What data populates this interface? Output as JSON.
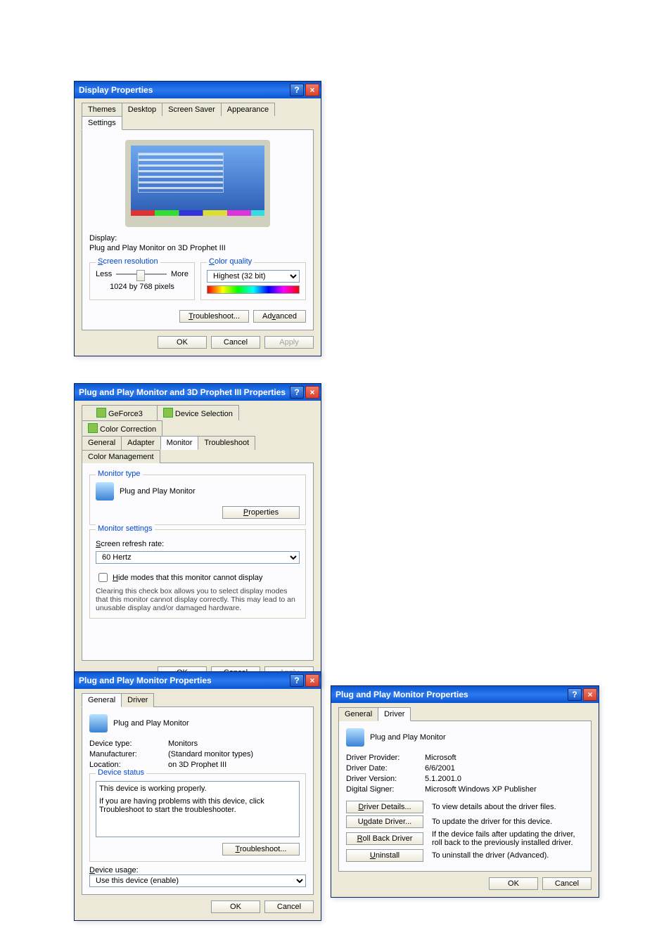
{
  "dlg1": {
    "title": "Display Properties",
    "tabs": [
      "Themes",
      "Desktop",
      "Screen Saver",
      "Appearance",
      "Settings"
    ],
    "selected_tab": "Settings",
    "display_label": "Display:",
    "display_value": "Plug and Play Monitor on 3D Prophet III",
    "res_legend": "Screen resolution",
    "res_less": "Less",
    "res_more": "More",
    "res_value": "1024 by 768 pixels",
    "cq_legend": "Color quality",
    "cq_value": "Highest (32 bit)",
    "troubleshoot_btn": "Troubleshoot...",
    "advanced_btn": "Advanced",
    "ok": "OK",
    "cancel": "Cancel",
    "apply": "Apply"
  },
  "dlg2": {
    "title": "Plug and Play Monitor and 3D Prophet III Properties",
    "tabs_row1": [
      "GeForce3",
      "Device Selection",
      "Color Correction"
    ],
    "tabs_row2": [
      "General",
      "Adapter",
      "Monitor",
      "Troubleshoot",
      "Color Management"
    ],
    "selected_tab": "Monitor",
    "mt_legend": "Monitor type",
    "mt_name": "Plug and Play Monitor",
    "properties_btn": "Properties",
    "ms_legend": "Monitor settings",
    "refresh_label": "Screen refresh rate:",
    "refresh_value": "60 Hertz",
    "hide_modes": "Hide modes that this monitor cannot display",
    "hide_help": "Clearing this check box allows you to select display modes that this monitor cannot display correctly. This may lead to an unusable display and/or damaged hardware.",
    "ok": "OK",
    "cancel": "Cancel",
    "apply": "Apply"
  },
  "dlg3": {
    "title": "Plug and Play Monitor Properties",
    "tabs": [
      "General",
      "Driver"
    ],
    "selected_tab": "General",
    "header": "Plug and Play Monitor",
    "devtype_l": "Device type:",
    "devtype_v": "Monitors",
    "mfr_l": "Manufacturer:",
    "mfr_v": "(Standard monitor types)",
    "loc_l": "Location:",
    "loc_v": "on 3D Prophet III",
    "status_legend": "Device status",
    "status_text": "This device is working properly.",
    "status_help": "If you are having problems with this device, click Troubleshoot to start the troubleshooter.",
    "troubleshoot_btn": "Troubleshoot...",
    "usage_label": "Device usage:",
    "usage_value": "Use this device (enable)",
    "ok": "OK",
    "cancel": "Cancel"
  },
  "dlg4": {
    "title": "Plug and Play Monitor Properties",
    "tabs": [
      "General",
      "Driver"
    ],
    "selected_tab": "Driver",
    "header": "Plug and Play Monitor",
    "provider_l": "Driver Provider:",
    "provider_v": "Microsoft",
    "date_l": "Driver Date:",
    "date_v": "6/6/2001",
    "version_l": "Driver Version:",
    "version_v": "5.1.2001.0",
    "signer_l": "Digital Signer:",
    "signer_v": "Microsoft Windows XP Publisher",
    "details_btn": "Driver Details...",
    "details_txt": "To view details about the driver files.",
    "update_btn": "Update Driver...",
    "update_txt": "To update the driver for this device.",
    "rollback_btn": "Roll Back Driver",
    "rollback_txt": "If the device fails after updating the driver, roll back to the previously installed driver.",
    "uninstall_btn": "Uninstall",
    "uninstall_txt": "To uninstall the driver (Advanced).",
    "ok": "OK",
    "cancel": "Cancel"
  }
}
